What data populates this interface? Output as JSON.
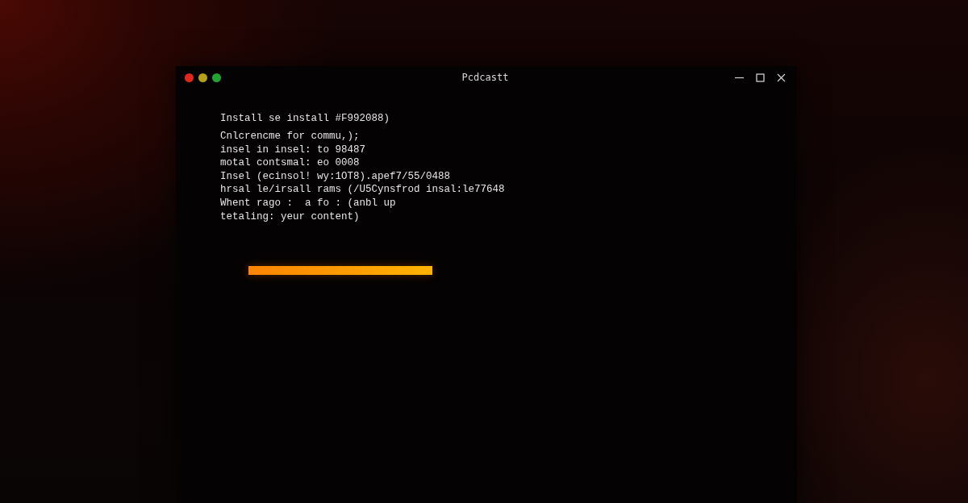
{
  "window": {
    "title": "Pcdcastt"
  },
  "terminal": {
    "heading": "Install se install #F992088)",
    "lines": [
      "Cnlcrencme for commu,);",
      "insel in insel: to 98487",
      "motal contsmal: eo 0008",
      "Insel (ecinsol! wy:1OT8).apef7/55/0488",
      "hrsal le/irsall rams (/U5Cynsfrod insal:le77648",
      "Whent rago :  a fo : (anbl up",
      "tetaling: yeur content)"
    ]
  }
}
